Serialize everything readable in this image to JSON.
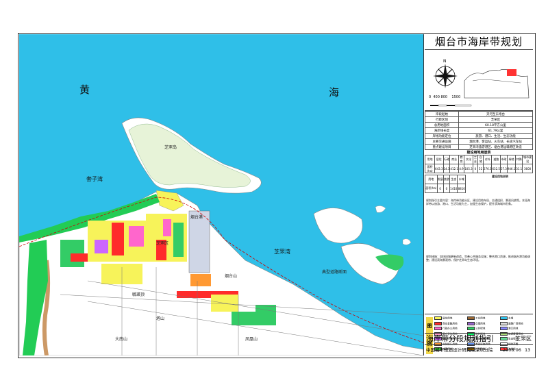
{
  "map": {
    "sea_label_1a": "黄",
    "sea_label_1b": "海",
    "bay_west": "套子湾",
    "bay_east": "芝罘湾",
    "island_peninsula": "芝罘岛",
    "place_labels": [
      "典型道路断面",
      "烟台山",
      "烟台港",
      "毓璜顶",
      "塔山",
      "大南山",
      "芝罘区",
      "凤凰山"
    ]
  },
  "panel": {
    "title": "烟台市海岸带规划",
    "scale_ticks": [
      "0",
      "400",
      "800",
      "1500"
    ],
    "info_rows": [
      {
        "k": "岸段起始",
        "v": "夹河至东炮台"
      },
      {
        "k": "行政区划",
        "v": "芝罘区"
      },
      {
        "k": "总用地面积",
        "v": "60.18平方公里"
      },
      {
        "k": "海岸线长度",
        "v": "61.79公里"
      },
      {
        "k": "岸线功能定位",
        "v": "旅游、港口、生活、生态功能"
      },
      {
        "k": "主要交通设施",
        "v": "烟台港、客运站、火车站、长途汽车站"
      },
      {
        "k": "重点建设项目",
        "v": "芝罘湾旅游港区、烟台港运输港区改造"
      }
    ],
    "stat_title": "建设用地用途表",
    "stat_row1": [
      "用地",
      "居住",
      "行政",
      "商业",
      "教育",
      "文化",
      "工业",
      "仓储",
      "对外",
      "道路",
      "市政",
      "绿地",
      "特殊",
      "城市建设"
    ],
    "stat_row2": [
      "面积(ha)",
      "643.3",
      "14.3",
      "412.1",
      "4.9",
      "105.3",
      "0",
      "52",
      "276.3",
      "632.5",
      "57.3",
      "946.1",
      "31.1",
      "3600"
    ],
    "stat_row3": [
      "用地",
      "发展",
      "旅游",
      "生态",
      "水域",
      "道路"
    ],
    "stat_row4": [
      "面积(ha)",
      "0",
      "0",
      "1410",
      "8810"
    ],
    "detail_title": "建设用地说明",
    "paragraph_1": "规划指引主要内容：海岸带功能分区、建设用地布局、交通组织、景观风貌等。本段海岸带以旅游、港口、生活功能为主，加强生态保护，提升滨海城市形象。",
    "paragraph_2": "规划措施：加快旧城更新改造，完善公共服务设施；整合港口资源，推进烟台港功能调整；建设滨海景观带，保护芝罘岛生态环境。",
    "legend_label": "图例",
    "legend_items": [
      {
        "name": "居住用地",
        "color": "#f7f35a"
      },
      {
        "name": "商业金融用地",
        "color": "#ff2b2b"
      },
      {
        "name": "行政办公用地",
        "color": "#ff66cc"
      },
      {
        "name": "医疗卫生用地",
        "color": "#ff99cc"
      },
      {
        "name": "教育科研用地",
        "color": "#cc66ff"
      },
      {
        "name": "文化娱乐用地",
        "color": "#ff9933"
      },
      {
        "name": "体育用地",
        "color": "#33cc33"
      },
      {
        "name": "工业用地",
        "color": "#996633"
      },
      {
        "name": "仓储用地",
        "color": "#9966cc"
      },
      {
        "name": "公共绿地",
        "color": "#33cc66"
      },
      {
        "name": "防护绿地",
        "color": "#00ff66"
      },
      {
        "name": "对外交通用地",
        "color": "#cccccc"
      },
      {
        "name": "市政设施用地",
        "color": "#6699ff"
      },
      {
        "name": "特殊用地",
        "color": "#996600"
      },
      {
        "name": "水域",
        "color": "#2fbfe8"
      },
      {
        "name": "道路广场用地",
        "color": "#dddddd"
      },
      {
        "name": "港口用地",
        "color": "#8888ff"
      },
      {
        "name": "旅游度假用地",
        "color": "#aadd77"
      },
      {
        "name": "生态绿地",
        "color": "#66dd99"
      },
      {
        "name": "规划范围",
        "color": "#ffffff"
      },
      {
        "name": "海岸线",
        "color": "#ff3333"
      }
    ],
    "footer_title": "海岸带分段规划指引",
    "footer_district": "芝罘区",
    "institute": "中国城市规划设计研究院深圳分院",
    "date": "2008.06",
    "sheet_no": "13"
  }
}
